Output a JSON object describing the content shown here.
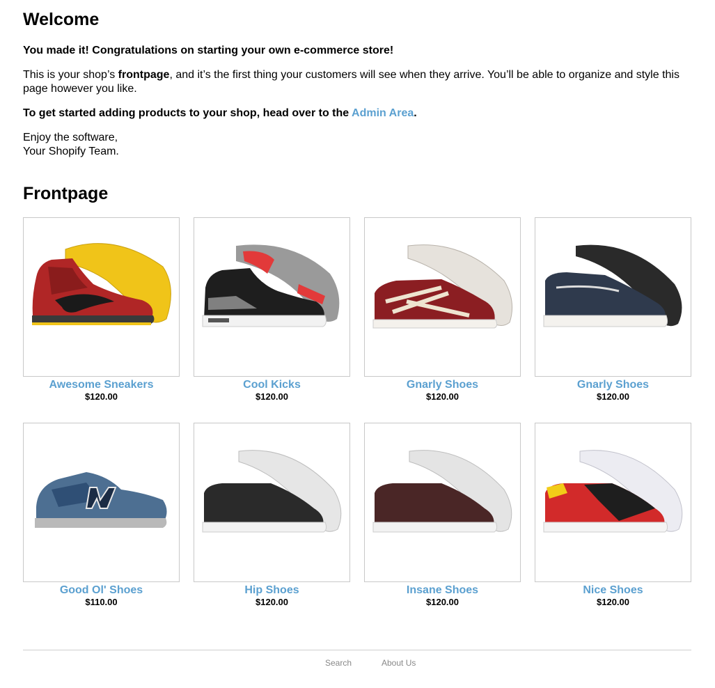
{
  "welcome": {
    "title": "Welcome",
    "congrats": "You made it! Congratulations on starting your own e-commerce store!",
    "intro_before": "This is your shop’s ",
    "intro_bold": "frontpage",
    "intro_after": ", and it’s the first thing your customers will see when they arrive. You’ll be able to organize and style this page however you like.",
    "getstarted_text": "To get started adding products to your shop, head over to the ",
    "admin_link": "Admin Area",
    "getstarted_end": ".",
    "signoff_line1": "Enjoy the software,",
    "signoff_line2": "Your Shopify Team."
  },
  "frontpage": {
    "title": "Frontpage",
    "products": [
      {
        "name": "Awesome Sneakers",
        "price": "$120.00",
        "icon": "red-high-top-sneaker"
      },
      {
        "name": "Cool Kicks",
        "price": "$120.00",
        "icon": "black-cement-sneaker"
      },
      {
        "name": "Gnarly Shoes",
        "price": "$120.00",
        "icon": "maroon-sneaker"
      },
      {
        "name": "Gnarly Shoes",
        "price": "$120.00",
        "icon": "navy-boat-shoe"
      },
      {
        "name": "Good Ol' Shoes",
        "price": "$110.00",
        "icon": "blue-runner"
      },
      {
        "name": "Hip Shoes",
        "price": "$120.00",
        "icon": "black-leather-sneaker"
      },
      {
        "name": "Insane Shoes",
        "price": "$120.00",
        "icon": "brown-leather-sneaker"
      },
      {
        "name": "Nice Shoes",
        "price": "$120.00",
        "icon": "red-yellow-sneaker"
      }
    ]
  },
  "footer": {
    "links": [
      "Search",
      "About Us"
    ]
  },
  "colors": {
    "link": "#5ba0d0",
    "border": "#c8c8c8"
  }
}
